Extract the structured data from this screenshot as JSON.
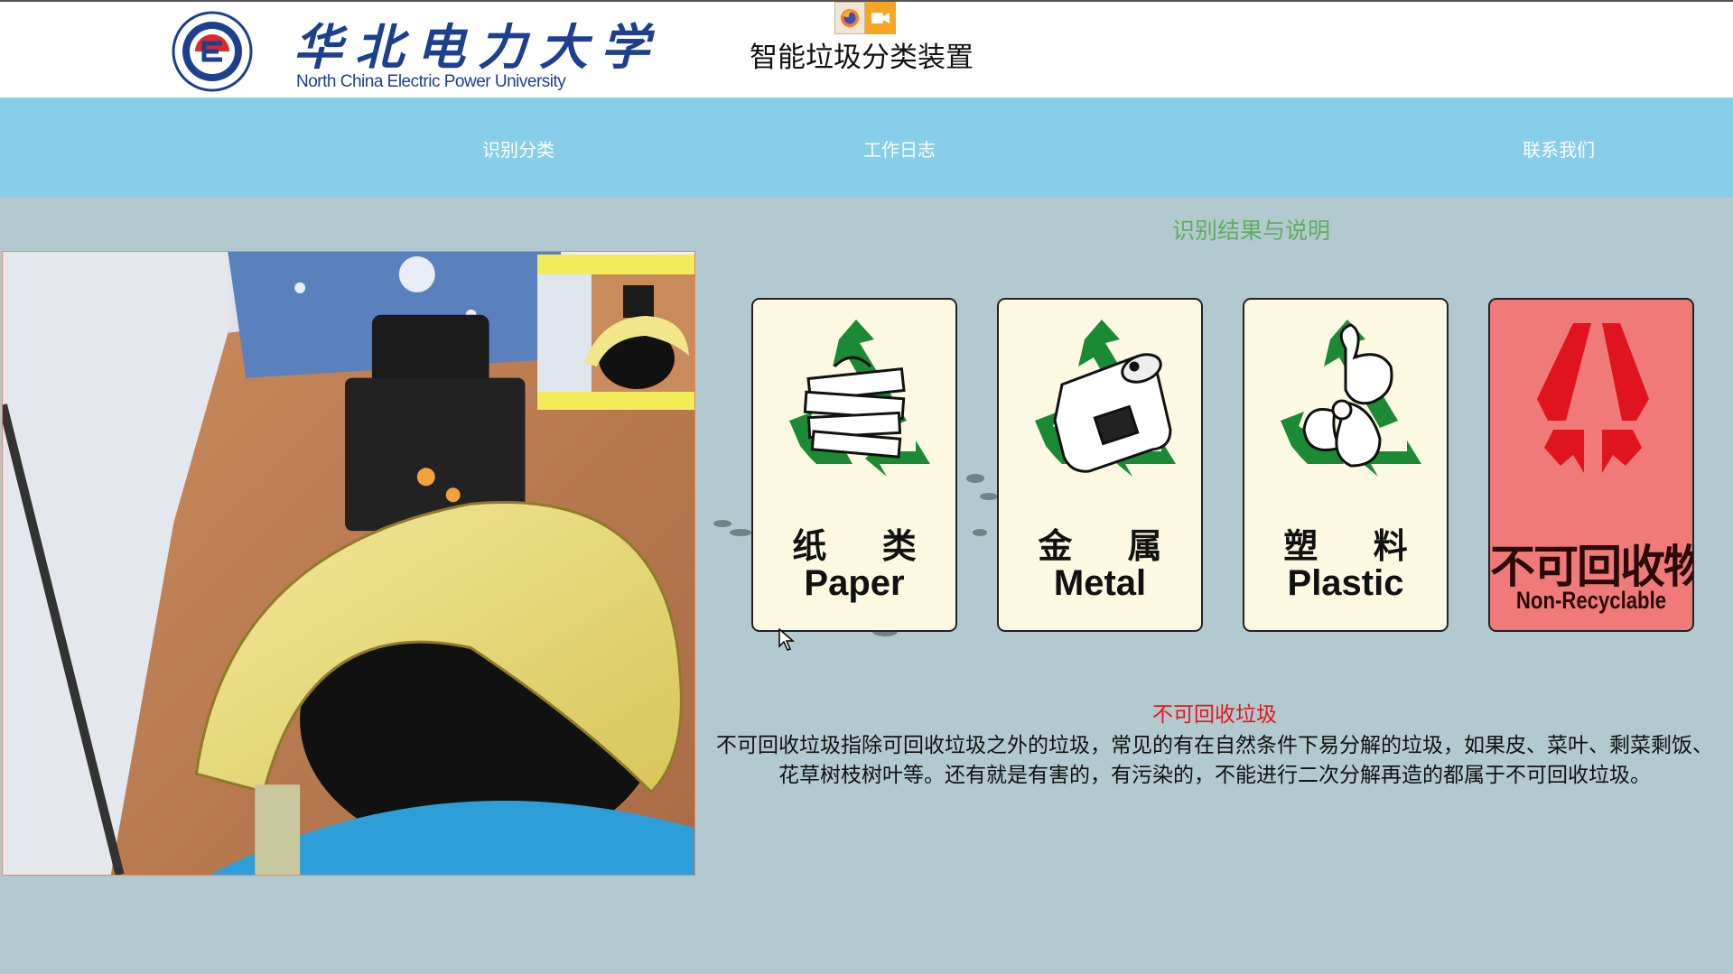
{
  "header": {
    "university_cn": "华北电力大学",
    "university_en": "North China Electric Power University",
    "app_title": "智能垃圾分类装置"
  },
  "tray": {
    "icons": [
      "firefox-icon",
      "camera-icon"
    ]
  },
  "nav": {
    "items": [
      {
        "label": "识别分类"
      },
      {
        "label": "工作日志"
      },
      {
        "label": "联系我们"
      }
    ]
  },
  "main": {
    "section_title": "识别结果与说明",
    "cards": [
      {
        "cn": "纸 类",
        "en": "Paper",
        "icon": "paper-recycle-icon"
      },
      {
        "cn": "金 属",
        "en": "Metal",
        "icon": "metal-recycle-icon"
      },
      {
        "cn": "塑 料",
        "en": "Plastic",
        "icon": "plastic-recycle-icon"
      },
      {
        "cn": "不可回收物",
        "en": "Non-Recyclable",
        "icon": "non-recyclable-icon",
        "active": true
      }
    ],
    "result_title": "不可回收垃圾",
    "result_desc": "不可回收垃圾指除可回收垃圾之外的垃圾，常见的有在自然条件下易分解的垃圾，如果皮、菜叶、剩菜剩饭、花草树枝树叶等。还有就是有害的，有污染的，不能进行二次分解再造的都属于不可回收垃圾。"
  },
  "colors": {
    "nav_bg": "#87ceeb",
    "page_bg": "#b3c9d0",
    "recycle_green": "#1a8a35",
    "non_recyclable_red": "#e0141e",
    "result_title": "#e01818"
  }
}
